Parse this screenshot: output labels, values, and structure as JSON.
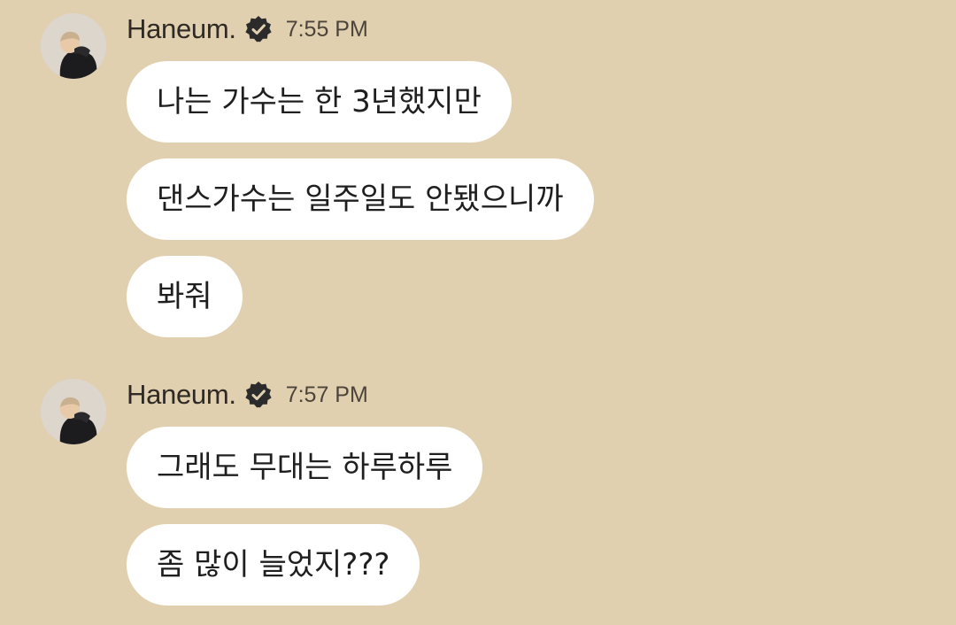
{
  "background": "#e1d0b0",
  "groups": [
    {
      "sender": "Haneum.",
      "time": "7:55 PM",
      "avatar_icon": "user-avatar-photo",
      "badge_icon": "verified-badge-icon",
      "messages": [
        "나는 가수는 한 3년했지만",
        "댄스가수는 일주일도 안됐으니까",
        "봐줘"
      ]
    },
    {
      "sender": "Haneum.",
      "time": "7:57 PM",
      "avatar_icon": "user-avatar-photo",
      "badge_icon": "verified-badge-icon",
      "messages": [
        "그래도 무대는 하루하루",
        "좀 많이 늘었지???"
      ]
    }
  ]
}
